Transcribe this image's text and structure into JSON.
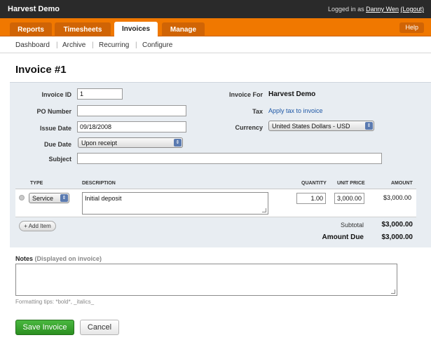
{
  "app": {
    "title": "Harvest Demo"
  },
  "user": {
    "prefix": "Logged in as",
    "name": "Danny Wen",
    "logout": "(Logout)"
  },
  "tabs": [
    {
      "label": "Reports"
    },
    {
      "label": "Timesheets"
    },
    {
      "label": "Invoices",
      "active": true
    },
    {
      "label": "Manage"
    }
  ],
  "help_label": "Help",
  "subnav": [
    "Dashboard",
    "Archive",
    "Recurring",
    "Configure"
  ],
  "page_title": "Invoice #1",
  "form": {
    "invoice_id": {
      "label": "Invoice ID",
      "value": "1"
    },
    "po_number": {
      "label": "PO Number",
      "value": ""
    },
    "issue_date": {
      "label": "Issue Date",
      "value": "09/18/2008"
    },
    "due_date": {
      "label": "Due Date",
      "value": "Upon receipt"
    },
    "subject": {
      "label": "Subject",
      "value": ""
    },
    "invoice_for": {
      "label": "Invoice For",
      "value": "Harvest Demo"
    },
    "tax": {
      "label": "Tax",
      "link": "Apply tax to invoice"
    },
    "currency": {
      "label": "Currency",
      "value": "United States Dollars - USD"
    }
  },
  "items": {
    "headers": {
      "type": "TYPE",
      "description": "DESCRIPTION",
      "quantity": "QUANTITY",
      "unit_price": "UNIT PRICE",
      "amount": "AMOUNT"
    },
    "rows": [
      {
        "type": "Service",
        "description": "Initial deposit",
        "quantity": "1.00",
        "unit_price": "3,000.00",
        "amount": "$3,000.00"
      }
    ],
    "add_label": "+ Add Item"
  },
  "totals": {
    "subtotal_label": "Subtotal",
    "subtotal": "$3,000.00",
    "amount_due_label": "Amount Due",
    "amount_due": "$3,000.00"
  },
  "notes": {
    "label": "Notes",
    "sub": "(Displayed on invoice)",
    "value": ""
  },
  "formatting_tips": "Formatting tips: *bold*, _italics_",
  "actions": {
    "save": "Save Invoice",
    "cancel": "Cancel"
  },
  "colors": {
    "topbar": "#2a2a2a",
    "accent": "#f07800",
    "panel": "#e8edf2",
    "save": "#3aa32f",
    "link": "#1f58a6"
  }
}
